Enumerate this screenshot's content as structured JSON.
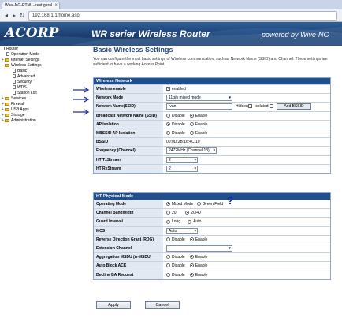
{
  "browser": {
    "tab_title": "Wive-NG-RTNL - rest geral",
    "tab_close": "×",
    "url": "192.168.1.1/home.asp",
    "back": "◂",
    "forward": "▸",
    "reload": "↻"
  },
  "header": {
    "logo": "ACORP",
    "logo_mark": "®",
    "title": "WR serier Wireless Router",
    "powered_by": "powered by Wive-NG"
  },
  "sidebar": {
    "items": [
      {
        "label": "Router",
        "level": 0,
        "type": "root"
      },
      {
        "label": "Operation Mode",
        "level": 1,
        "type": "page"
      },
      {
        "label": "Internet Settings",
        "level": 1,
        "type": "folder"
      },
      {
        "label": "Wireless Settings",
        "level": 1,
        "type": "folder-open"
      },
      {
        "label": "Basic",
        "level": 2,
        "type": "page"
      },
      {
        "label": "Advanced",
        "level": 2,
        "type": "page"
      },
      {
        "label": "Security",
        "level": 2,
        "type": "page"
      },
      {
        "label": "WDS",
        "level": 2,
        "type": "page"
      },
      {
        "label": "Station List",
        "level": 2,
        "type": "page"
      },
      {
        "label": "Services",
        "level": 1,
        "type": "folder"
      },
      {
        "label": "Firewall",
        "level": 1,
        "type": "folder"
      },
      {
        "label": "USB Apps",
        "level": 1,
        "type": "folder"
      },
      {
        "label": "Storage",
        "level": 1,
        "type": "folder"
      },
      {
        "label": "Administration",
        "level": 1,
        "type": "folder"
      }
    ]
  },
  "main": {
    "title": "Basic Wireless Settings",
    "intro": "You can configure the most basic settings of Wireless communication, such as Network Name (SSID) and Channel. These settings are sufficient to have a working Access Point.",
    "wireless_network": {
      "heading": "Wireless Network",
      "rows": {
        "enable": {
          "label": "Wireless enable",
          "value": "enabled",
          "checked": "✓"
        },
        "mode": {
          "label": "Network Mode",
          "value": "11g/n mixed mode"
        },
        "ssid": {
          "label": "Network Name(SSID)",
          "value": "Ivan",
          "hidden": "Hidden",
          "isolated": "Isolated",
          "add_button": "Add BSSID"
        },
        "bssid_broadcast": {
          "label": "Broadcast Network Name (SSID)",
          "opt1": "Disable",
          "opt2": "Enable"
        },
        "ap_isolation": {
          "label": "AP Isolation",
          "opt1": "Disable",
          "opt2": "Enable"
        },
        "mbssid_isolation": {
          "label": "MBSSID AP Isolation",
          "opt1": "Disable",
          "opt2": "Enable"
        },
        "bssid": {
          "label": "BSSID",
          "value": "00:0D:2B:16:4C:10"
        },
        "frequency": {
          "label": "Frequency (Channel)",
          "value": "2472MHz (Channel 13)"
        },
        "tx_stream": {
          "label": "HT TxStream",
          "value": "2"
        },
        "rx_stream": {
          "label": "HT RxStream",
          "value": "2"
        }
      }
    },
    "ht_physical": {
      "heading": "HT Physical Mode",
      "rows": {
        "op_mode": {
          "label": "Operating Mode",
          "opt1": "Mixed Mode",
          "opt2": "Green Field"
        },
        "bandwidth": {
          "label": "Channel BandWidth",
          "opt1": "20",
          "opt2": "20/40"
        },
        "guard": {
          "label": "Guard Interval",
          "opt1": "Long",
          "opt2": "Auto"
        },
        "mcs": {
          "label": "MCS",
          "value": "Auto"
        },
        "rdg": {
          "label": "Reverse Direction Grant (RDG)",
          "opt1": "Disable",
          "opt2": "Enable"
        },
        "ext_channel": {
          "label": "Extension Channel",
          "value": ""
        },
        "amsdu": {
          "label": "Aggregation MSDU (A-MSDU)",
          "opt1": "Disable",
          "opt2": "Enable"
        },
        "auto_block_ack": {
          "label": "Auto Block ACK",
          "opt1": "Disable",
          "opt2": "Enable"
        },
        "decline_ba": {
          "label": "Decline BA Request",
          "opt1": "Disable",
          "opt2": "Enable"
        }
      }
    },
    "buttons": {
      "apply": "Apply",
      "cancel": "Cancel"
    },
    "annotation": {
      "question": "?"
    }
  },
  "colors": {
    "header": "#1f4f8e",
    "label_bg": "#e2e9f3",
    "annotation_arrow": "#1a2fa0"
  }
}
